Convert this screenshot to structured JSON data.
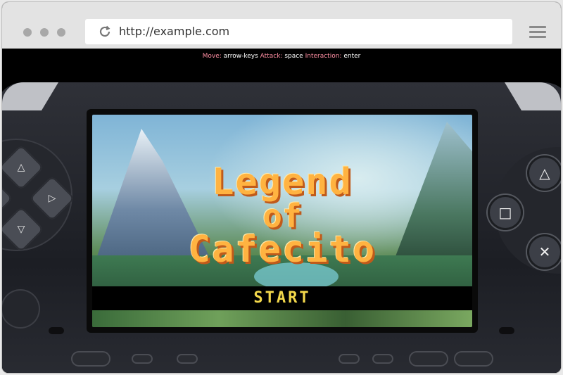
{
  "browser": {
    "url": "http://example.com"
  },
  "game": {
    "hint": {
      "move_key": "Move:",
      "move_val": "arrow-keys",
      "attack_key": "Attack:",
      "attack_val": "space",
      "interact_key": "Interaction:",
      "interact_val": "enter"
    },
    "title_line1": "Legend",
    "title_line2": "of",
    "title_line3": "Cafecito",
    "start_label": "START"
  },
  "controls": {
    "up": "△",
    "right": "▷",
    "down": "▽",
    "triangle": "△",
    "square": "□",
    "cross": "✕"
  },
  "colors": {
    "title": "#ffb341",
    "start": "#f3d84b",
    "hint_key": "#ff8fa3"
  }
}
